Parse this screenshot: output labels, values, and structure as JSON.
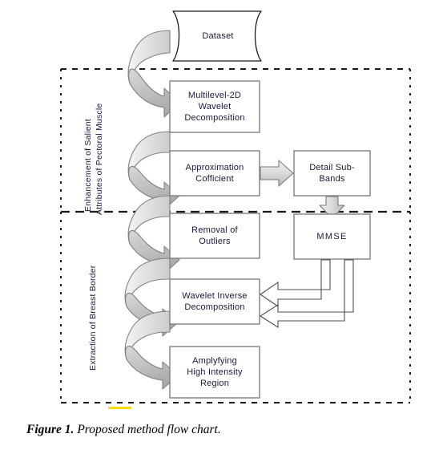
{
  "figure": {
    "caption_label": "Figure 1.",
    "caption_text": " Proposed method flow chart."
  },
  "bands": [
    {
      "id": "enhancement-band",
      "line1": "Enhancement of Salient",
      "line2": "Attributes of Pectoral Muscle"
    },
    {
      "id": "extraction-band",
      "line1": "Extraction of Breast Border",
      "line2": ""
    }
  ],
  "nodes": {
    "dataset": {
      "line1": "Dataset",
      "line2": "",
      "line3": ""
    },
    "multilevel": {
      "line1": "Multilevel-2D",
      "line2": "Wavelet",
      "line3": "Decomposition"
    },
    "approximation": {
      "line1": "Approximation",
      "line2": "Cofficient",
      "line3": ""
    },
    "detail_sub_bands": {
      "line1": "Detail Sub-",
      "line2": "Bands",
      "line3": ""
    },
    "removal": {
      "line1": "Removal of",
      "line2": "Outliers",
      "line3": ""
    },
    "mmse": {
      "line1": "MMSE",
      "line2": "",
      "line3": ""
    },
    "wavelet_inverse": {
      "line1": "Wavelet Inverse",
      "line2": "Decomposition",
      "line3": ""
    },
    "amplyfying": {
      "line1": "Amplyfying",
      "line2": "High Intensity",
      "line3": "Region"
    }
  },
  "colors": {
    "box_stroke": "#808080",
    "box_fill": "#ffffff",
    "arrow_fill_light": "#e8e8e8",
    "arrow_fill_mid": "#c8c8c8",
    "arrow_stroke": "#7a7a7a",
    "dashed_border": "#1a1a1a",
    "text": "#1a1a3c",
    "highlight": "#ffdd00"
  },
  "chart_data": {
    "type": "diagram",
    "title": "Proposed method flow chart",
    "nodes": [
      {
        "id": "dataset",
        "label": "Dataset",
        "shape": "document",
        "band": null
      },
      {
        "id": "multilevel",
        "label": "Multilevel-2D Wavelet Decomposition",
        "shape": "rect",
        "band": "enhancement-band"
      },
      {
        "id": "approximation",
        "label": "Approximation Cofficient",
        "shape": "rect",
        "band": "enhancement-band"
      },
      {
        "id": "detail_sub_bands",
        "label": "Detail Sub-Bands",
        "shape": "rect",
        "band": "enhancement-band"
      },
      {
        "id": "removal",
        "label": "Removal of Outliers",
        "shape": "rect",
        "band": "extraction-band"
      },
      {
        "id": "mmse",
        "label": "MMSE",
        "shape": "rect",
        "band": "extraction-band"
      },
      {
        "id": "wavelet_inverse",
        "label": "Wavelet Inverse Decomposition",
        "shape": "rect",
        "band": "extraction-band"
      },
      {
        "id": "amplyfying",
        "label": "Amplyfying High Intensity Region",
        "shape": "rect",
        "band": "extraction-band"
      }
    ],
    "edges": [
      {
        "from": "dataset",
        "to": "multilevel",
        "style": "curved-block-arrow"
      },
      {
        "from": "multilevel",
        "to": "approximation",
        "style": "curved-block-arrow"
      },
      {
        "from": "approximation",
        "to": "detail_sub_bands",
        "style": "straight-block-arrow"
      },
      {
        "from": "approximation",
        "to": "removal",
        "style": "curved-block-arrow"
      },
      {
        "from": "detail_sub_bands",
        "to": "mmse",
        "style": "straight-block-arrow-down"
      },
      {
        "from": "removal",
        "to": "wavelet_inverse",
        "style": "curved-block-arrow"
      },
      {
        "from": "mmse",
        "to": "wavelet_inverse",
        "style": "elbow-arrow"
      },
      {
        "from": "mmse",
        "to": "wavelet_inverse",
        "style": "elbow-arrow"
      },
      {
        "from": "wavelet_inverse",
        "to": "amplyfying",
        "style": "curved-block-arrow"
      }
    ]
  }
}
